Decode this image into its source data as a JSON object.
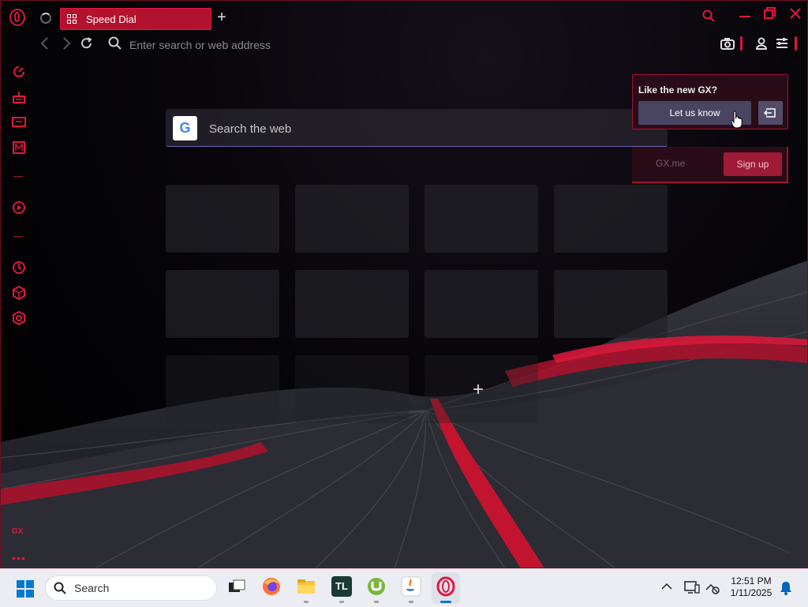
{
  "browser": {
    "tab": {
      "label": "Speed Dial"
    },
    "address_bar": {
      "placeholder": "Enter search or web address"
    }
  },
  "speed_dial": {
    "search": {
      "placeholder": "Search the web",
      "engine_letter": "G"
    },
    "add_tile_symbol": "+"
  },
  "popup": {
    "title": "Like the new GX?",
    "primary_button": "Let us know",
    "gx_link": "GX.me",
    "signup_button": "Sign up"
  },
  "sidebar": {
    "brand_label": "GX",
    "more_label": "•••"
  },
  "taskbar": {
    "search_label": "Search",
    "time": "12:51 PM",
    "date": "1/11/2025",
    "apps": [
      "task-view",
      "firefox",
      "file-explorer",
      "tl",
      "utorrent",
      "java",
      "opera-gx"
    ],
    "tl_label": "TL"
  },
  "colors": {
    "accent": "#e0173f",
    "tab_bg": "#b3122f",
    "popup_bg": "#2a0c18",
    "taskbar_bg": "#ecedf2"
  }
}
